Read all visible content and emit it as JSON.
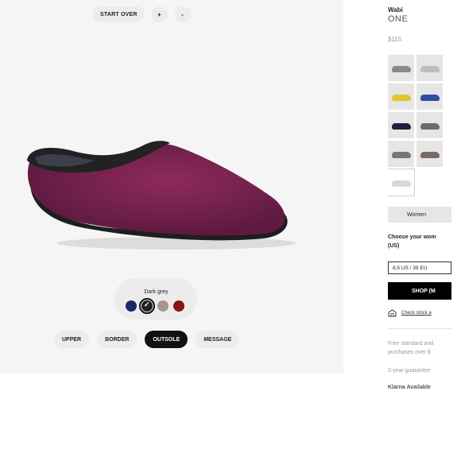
{
  "top_controls": {
    "start_over": "START OVER",
    "zoom_in": "+",
    "zoom_out": "-"
  },
  "product_color": "#7a2250",
  "color_picker": {
    "selected_label": "Dark grey",
    "swatches": [
      {
        "name": "navy",
        "color": "#1b2a6b",
        "selected": false
      },
      {
        "name": "dark-grey",
        "color": "#222222",
        "selected": true
      },
      {
        "name": "taupe",
        "color": "#a8968a",
        "selected": false
      },
      {
        "name": "red",
        "color": "#8b1414",
        "selected": false
      }
    ]
  },
  "tabs": [
    {
      "label": "UPPER",
      "active": false
    },
    {
      "label": "BORDER",
      "active": false
    },
    {
      "label": "OUTSOLE",
      "active": true
    },
    {
      "label": "MESSAGE",
      "active": false
    }
  ],
  "panel": {
    "brand": "Wabi",
    "brand_sub": "ONE",
    "price": "$115",
    "thumbnails": [
      {
        "color": "#8a8a8a",
        "selected": false
      },
      {
        "color": "#bdbdbd",
        "selected": false
      },
      {
        "color": "#e2c52a",
        "selected": false
      },
      {
        "color": "#2a4fa0",
        "selected": false
      },
      {
        "color": "#1b2240",
        "selected": false
      },
      {
        "color": "#6b6b6b",
        "selected": false
      },
      {
        "color": "#777777",
        "selected": false
      },
      {
        "color": "#7a6a66",
        "selected": false
      },
      {
        "color": "#d8d8d8",
        "selected": true
      }
    ],
    "gender_tab": "Women",
    "size_question": "Choose your wom (US)",
    "size_value": "8,5 US / 39 EU",
    "shop_label": "SHOP (M",
    "stock_link": "Check stock a",
    "shipping_info": "Free standard and purchases over $",
    "guarantee": "2-year guarantee",
    "klarna": "Klarna Available"
  }
}
